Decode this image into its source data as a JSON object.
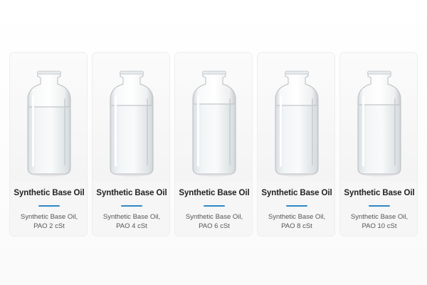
{
  "products": [
    {
      "title": "Synthetic Base Oil",
      "desc_line1": "Synthetic Base Oil,",
      "desc_line2": "PAO 2 cSt"
    },
    {
      "title": "Synthetic Base Oil",
      "desc_line1": "Synthetic Base Oil,",
      "desc_line2": "PAO 4 cSt"
    },
    {
      "title": "Synthetic Base Oil",
      "desc_line1": "Synthetic Base Oil,",
      "desc_line2": "PAO 6 cSt"
    },
    {
      "title": "Synthetic Base Oil",
      "desc_line1": "Synthetic Base Oil,",
      "desc_line2": "PAO 8 cSt"
    },
    {
      "title": "Synthetic Base Oil",
      "desc_line1": "Synthetic Base Oil,",
      "desc_line2": "PAO 10 cSt"
    }
  ],
  "colors": {
    "accent": "#2f86c6",
    "card_background": "#f6f6f6",
    "title_text": "#222222",
    "desc_text": "#555555"
  },
  "icons": {
    "product_image": "glass-bottle-icon"
  }
}
